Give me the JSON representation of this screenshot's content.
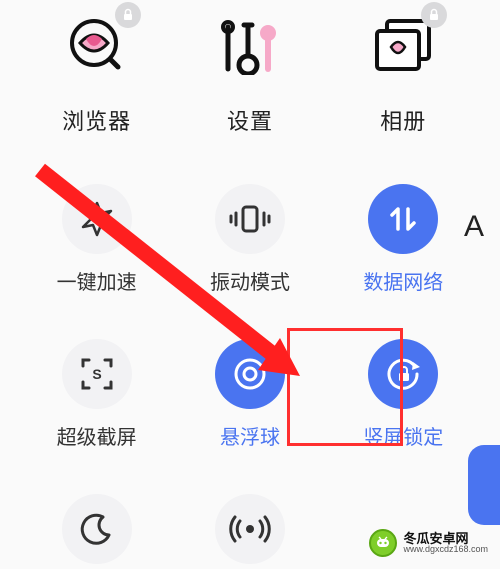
{
  "apps": [
    {
      "label": "浏览器",
      "icon": "browser-icon",
      "locked": true
    },
    {
      "label": "设置",
      "icon": "settings-icon",
      "locked": false
    },
    {
      "label": "相册",
      "icon": "gallery-icon",
      "locked": true
    }
  ],
  "quick_settings": {
    "row1": [
      {
        "label": "一键加速",
        "icon": "boost-icon",
        "active": false
      },
      {
        "label": "振动模式",
        "icon": "vibrate-icon",
        "active": false
      },
      {
        "label": "数据网络",
        "icon": "mobile-data-icon",
        "active": true
      }
    ],
    "row2": [
      {
        "label": "超级截屏",
        "icon": "screenshot-icon",
        "active": false
      },
      {
        "label": "悬浮球",
        "icon": "float-ball-icon",
        "active": true
      },
      {
        "label": "竖屏锁定",
        "icon": "rotation-lock-icon",
        "active": true
      }
    ],
    "row3_partial": [
      {
        "icon": "moon-icon",
        "active": false
      },
      {
        "icon": "hotspot-icon",
        "active": false
      }
    ]
  },
  "sidebar_letter": "A",
  "highlight_target": "竖屏锁定",
  "watermark": {
    "name": "冬瓜安卓网",
    "url": "www.dgxcdz168.com"
  }
}
